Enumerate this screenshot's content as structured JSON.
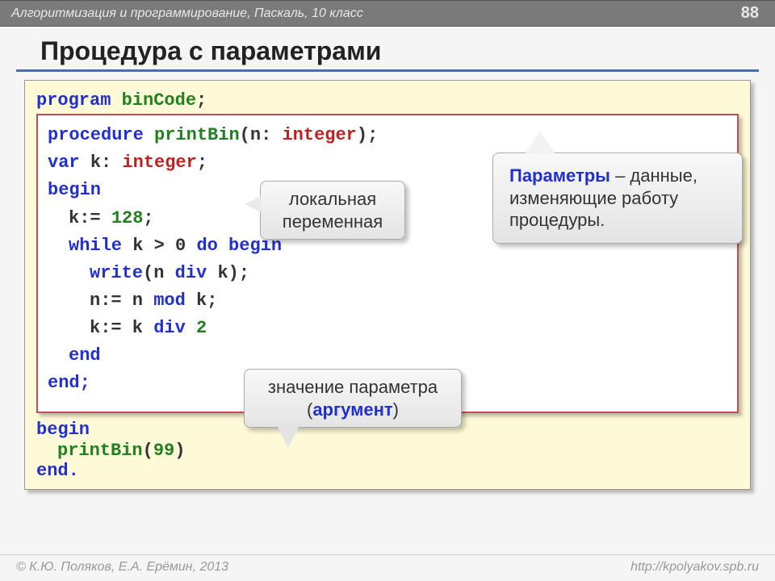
{
  "header": {
    "breadcrumb": "Алгоритмизация и программирование, Паскаль, 10 класс",
    "page_number": "88"
  },
  "title": "Процедура с параметрами",
  "outer_code": {
    "line1_kw": "program",
    "line1_name": "binCode",
    "begin": "begin",
    "call_proc": "printBin",
    "call_arg": "99",
    "end": "end."
  },
  "inner_code": {
    "proc_kw": "procedure",
    "proc_name": "printBin",
    "param_n": "n",
    "type_int": "integer",
    "var_kw": "var",
    "var_k": "k",
    "begin": "begin",
    "init_line": "k:=",
    "init_val": "128",
    "while_kw": "while",
    "cond": "k > 0",
    "do_begin": "do begin",
    "write_kw": "write",
    "write_expr": "(n",
    "div_kw": "div",
    "write_tail": "k);",
    "mod_line_a": "n:= n",
    "mod_kw": "mod",
    "mod_line_b": "k;",
    "kdiv_line_a": "k:= k",
    "kdiv_line_b": "2",
    "end1": "end",
    "end2": "end;"
  },
  "callouts": {
    "localvar": "локальная переменная",
    "params_term": "Параметры",
    "params_rest": " – данные, изменяющие работу процедуры.",
    "argument_a": "значение параметра (",
    "argument_term": "аргумент",
    "argument_b": ")"
  },
  "footer": {
    "left": "© К.Ю. Поляков, Е.А. Ерёмин, 2013",
    "right": "http://kpolyakov.spb.ru"
  }
}
